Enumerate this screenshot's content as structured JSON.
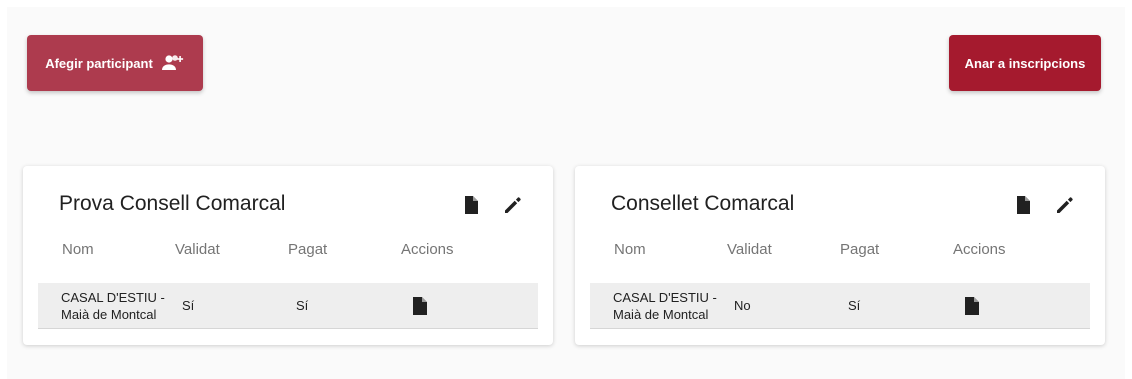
{
  "toolbar": {
    "add_participant_label": "Afegir participant",
    "go_to_inscriptions_label": "Anar a inscripcions"
  },
  "colors": {
    "add_button": "#ad3b4e",
    "go_button": "#a51a2e",
    "row_background": "#eeeeee"
  },
  "columns": {
    "name": "Nom",
    "validated": "Validat",
    "paid": "Pagat",
    "actions": "Accions"
  },
  "cards": [
    {
      "title": "Prova Consell Comarcal",
      "icons": [
        "file-icon",
        "edit-icon"
      ],
      "rows": [
        {
          "name": "CASAL D'ESTIU - Maià de Montcal",
          "validated": "Sí",
          "paid": "Sí",
          "action_icon": "file-icon"
        }
      ]
    },
    {
      "title": "Consellet Comarcal",
      "icons": [
        "file-icon",
        "edit-icon"
      ],
      "rows": [
        {
          "name": "CASAL D'ESTIU - Maià de Montcal",
          "validated": "No",
          "paid": "Sí",
          "action_icon": "file-icon"
        }
      ]
    }
  ]
}
